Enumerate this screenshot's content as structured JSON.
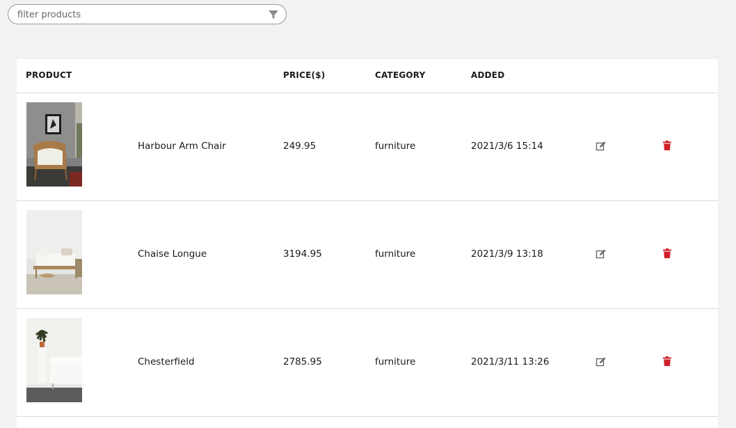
{
  "filter": {
    "placeholder": "filter products",
    "value": "",
    "icon": "filter-icon"
  },
  "table": {
    "headers": {
      "product": "PRODUCT",
      "price": "PRICE($)",
      "category": "CATEGORY",
      "added": "ADDED"
    },
    "rows": [
      {
        "image": "armchair-photo",
        "name": "Harbour Arm Chair",
        "price": "249.95",
        "category": "furniture",
        "added": "2021/3/6 15:14"
      },
      {
        "image": "daybed-photo",
        "name": "Chaise Longue",
        "price": "3194.95",
        "category": "furniture",
        "added": "2021/3/9 13:18"
      },
      {
        "image": "sofa-plant-photo",
        "name": "Chesterfield",
        "price": "2785.95",
        "category": "furniture",
        "added": "2021/3/11 13:26"
      }
    ],
    "actions": {
      "edit_icon": "edit-icon",
      "delete_icon": "trash-icon"
    }
  },
  "colors": {
    "background": "#f2f2f2",
    "delete": "#d0212b",
    "edit": "#666666"
  }
}
